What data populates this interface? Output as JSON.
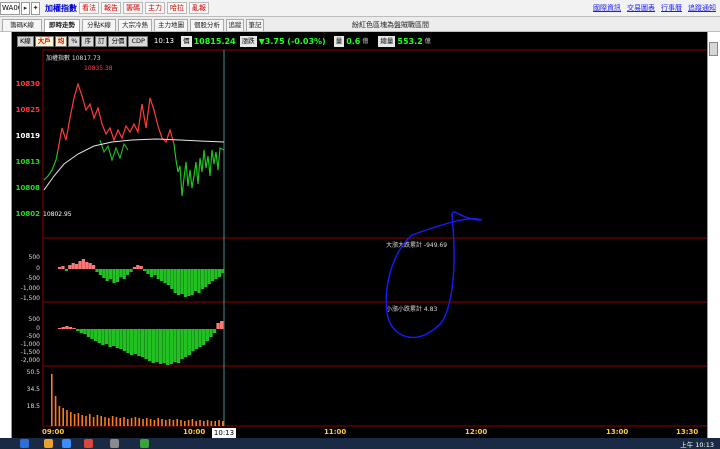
{
  "toolbar": {
    "code": "WA00",
    "index_title": "加權指數",
    "menu_items": [
      "看法",
      "報告",
      "籌碼",
      "主力",
      "哈拉",
      "亂報"
    ],
    "links": [
      "國際資訊",
      "交易圖表",
      "行事曆",
      "追蹤通知"
    ]
  },
  "tabs": [
    "籌碼K線",
    "即時走勢",
    "分點K線",
    "大宗冷熱",
    "主力地圖",
    "個股分析",
    "追蹤",
    "筆記"
  ],
  "note": "紛紅色區塊為盤賊戰區間",
  "period_buttons": [
    "K線",
    "大戶",
    "均",
    "%",
    "序",
    "訂",
    "分價",
    "CDP"
  ],
  "info": {
    "time": "10:13",
    "price_label": "價",
    "price": "10815.24",
    "change_label": "漲跌",
    "change": "▼3.75 (-0.03%)",
    "volume_label": "量",
    "volume": "0.6",
    "volume_unit": "億",
    "total_label": "總量",
    "total": "553.2",
    "total_unit": "億"
  },
  "main_chart": {
    "title": "加權指數 10817.73",
    "high_label": "10835.38",
    "low_label": "10802.95",
    "y_ticks": [
      "10830",
      "10825",
      "10819",
      "10813",
      "10808",
      "10802"
    ]
  },
  "panel1": {
    "title": "大漲大跌累計 -949.69",
    "y_ticks": [
      "500",
      "0",
      "-500",
      "-1,000",
      "-1,500"
    ]
  },
  "panel2": {
    "title": "小漲小跌累計 4.83",
    "y_ticks": [
      "500",
      "0",
      "-500",
      "-1,000",
      "-1,500",
      "-2,000"
    ]
  },
  "vol_panel": {
    "y_ticks": [
      "50.5",
      "34.5",
      "18.5"
    ]
  },
  "x_axis": {
    "ticks": [
      "09:00",
      "10:00",
      "11:00",
      "12:00",
      "13:00",
      "13:30"
    ],
    "cursor": "10:13"
  },
  "taskbar": {
    "clock": "上午 10:13"
  },
  "colors": {
    "up": "#ff3b3b",
    "down": "#22c022",
    "flat": "#ffffff",
    "grid": "#8b0000",
    "annotation": "#1a1aff"
  }
}
